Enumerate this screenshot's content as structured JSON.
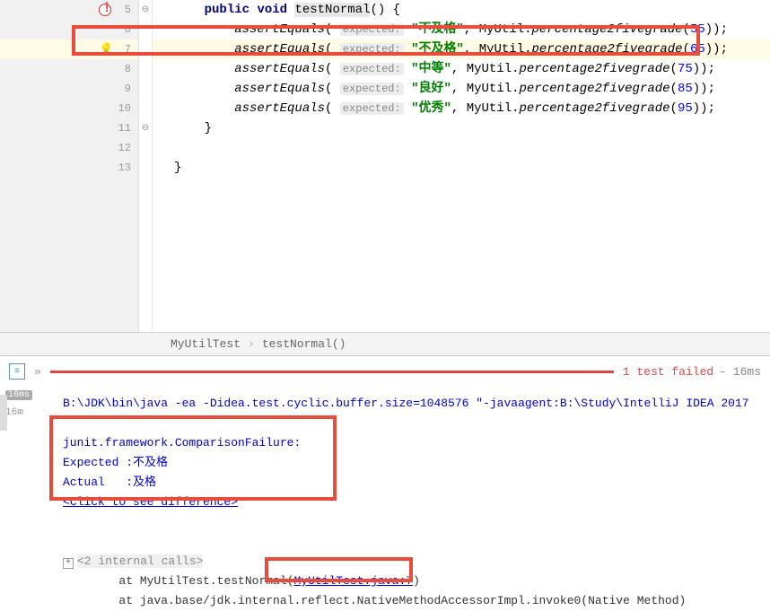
{
  "editor": {
    "lines": [
      {
        "num": "5",
        "icon": "error",
        "fold": "⊖",
        "indent": "    ",
        "content": [
          {
            "cls": "kw",
            "t": "public"
          },
          {
            "t": " "
          },
          {
            "cls": "kw",
            "t": "void"
          },
          {
            "t": " "
          },
          {
            "cls": "method-decl",
            "t": "testNormal"
          },
          {
            "t": "() {"
          }
        ]
      },
      {
        "num": "6",
        "indent": "        ",
        "content": [
          {
            "cls": "fn",
            "t": "assertEquals"
          },
          {
            "t": "( "
          },
          {
            "cls": "hint",
            "t": "expected:"
          },
          {
            "t": " "
          },
          {
            "cls": "str",
            "t": "\"不及格\""
          },
          {
            "t": ", MyUtil."
          },
          {
            "cls": "fn",
            "t": "percentage2fivegrade"
          },
          {
            "t": "("
          },
          {
            "cls": "num",
            "t": "55"
          },
          {
            "t": "));"
          }
        ]
      },
      {
        "num": "7",
        "hl": true,
        "icon": "bulb",
        "indent": "        ",
        "content": [
          {
            "cls": "fn",
            "t": "assertEquals"
          },
          {
            "t": "( "
          },
          {
            "cls": "hint",
            "t": "expected:"
          },
          {
            "t": " "
          },
          {
            "cls": "str",
            "t": "\"不及格\""
          },
          {
            "t": ", MyUtil."
          },
          {
            "cls": "fn",
            "t": "percentage2fivegrade"
          },
          {
            "t": "("
          },
          {
            "cls": "num",
            "t": "65"
          },
          {
            "t": "));"
          }
        ]
      },
      {
        "num": "8",
        "indent": "        ",
        "content": [
          {
            "cls": "fn",
            "t": "assertEquals"
          },
          {
            "t": "( "
          },
          {
            "cls": "hint",
            "t": "expected:"
          },
          {
            "t": " "
          },
          {
            "cls": "str",
            "t": "\"中等\""
          },
          {
            "t": ", MyUtil."
          },
          {
            "cls": "fn",
            "t": "percentage2fivegrade"
          },
          {
            "t": "("
          },
          {
            "cls": "num",
            "t": "75"
          },
          {
            "t": "));"
          }
        ]
      },
      {
        "num": "9",
        "indent": "        ",
        "content": [
          {
            "cls": "fn",
            "t": "assertEquals"
          },
          {
            "t": "( "
          },
          {
            "cls": "hint",
            "t": "expected:"
          },
          {
            "t": " "
          },
          {
            "cls": "str",
            "t": "\"良好\""
          },
          {
            "t": ", MyUtil."
          },
          {
            "cls": "fn",
            "t": "percentage2fivegrade"
          },
          {
            "t": "("
          },
          {
            "cls": "num",
            "t": "85"
          },
          {
            "t": "));"
          }
        ]
      },
      {
        "num": "10",
        "indent": "        ",
        "content": [
          {
            "cls": "fn",
            "t": "assertEquals"
          },
          {
            "t": "( "
          },
          {
            "cls": "hint",
            "t": "expected:"
          },
          {
            "t": " "
          },
          {
            "cls": "str",
            "t": "\"优秀\""
          },
          {
            "t": ", MyUtil."
          },
          {
            "cls": "fn",
            "t": "percentage2fivegrade"
          },
          {
            "t": "("
          },
          {
            "cls": "num",
            "t": "95"
          },
          {
            "t": "));"
          }
        ]
      },
      {
        "num": "11",
        "fold": "⊖",
        "indent": "    ",
        "content": [
          {
            "t": "}"
          }
        ]
      },
      {
        "num": "12",
        "indent": "",
        "content": []
      },
      {
        "num": "13",
        "indent": "",
        "content": [
          {
            "t": "}"
          }
        ]
      }
    ]
  },
  "breadcrumb": {
    "class": "MyUtilTest",
    "method": "testNormal()"
  },
  "testResult": {
    "fail_label": "1 test failed",
    "time": "– 16ms",
    "tree_time1": "16ms",
    "tree_time2": "16m"
  },
  "console": {
    "cmd": "B:\\JDK\\bin\\java -ea -Didea.test.cyclic.buffer.size=1048576 \"-javaagent:B:\\Study\\IntelliJ IDEA 2017",
    "failure_title": "junit.framework.ComparisonFailure: ",
    "expected_label": "Expected :",
    "expected_val": "不及格",
    "actual_label": "Actual   :",
    "actual_val": "及格",
    "click_diff": "<Click to see difference>",
    "internal_calls": "<2 internal calls>",
    "stack1_pre": "\tat MyUtilTest.testNormal",
    "stack1_link": "MyUtilTest.java:7",
    "stack2": "\tat java.base/jdk.internal.reflect.NativeMethodAccessorImpl.invoke0(Native Method)"
  }
}
